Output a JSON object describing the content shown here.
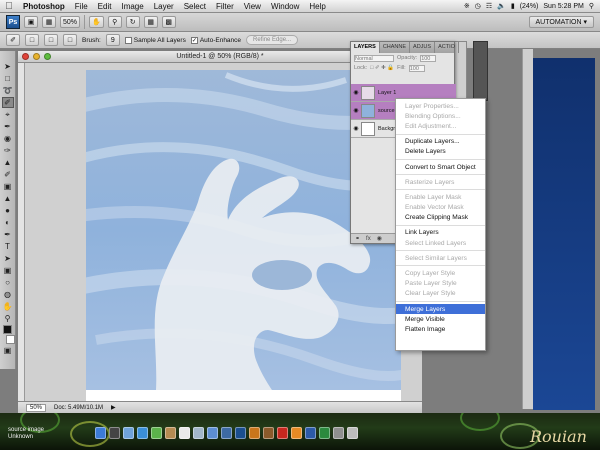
{
  "menubar": {
    "app_name": "Photoshop",
    "items": [
      "File",
      "Edit",
      "Image",
      "Layer",
      "Select",
      "Filter",
      "View",
      "Window",
      "Help"
    ],
    "battery": "(24%)",
    "clock": "Sun 5:28 PM"
  },
  "appbar": {
    "ps_label": "Ps",
    "zoom": "50%",
    "workspace": "AUTOMATION ▾"
  },
  "options": {
    "brush_label": "Brush:",
    "brush_size": "9",
    "sample_all_layers": "Sample All Layers",
    "auto_enhance": "Auto-Enhance",
    "refine_edge": "Refine Edge..."
  },
  "document": {
    "title": "Untitled-1 @ 50% (RGB/8) *",
    "zoom": "50%",
    "doc_size": "Doc: 5.49M/10.1M"
  },
  "layers_panel": {
    "tabs": [
      "LAYERS",
      "CHANNE",
      "ADJUS",
      "ACTIO"
    ],
    "blend_mode": "Normal",
    "opacity_label": "Opacity:",
    "opacity_value": "100",
    "lock_label": "Lock:",
    "fill_label": "Fill:",
    "fill_value": "100",
    "layers": [
      {
        "name": "Layer 1"
      },
      {
        "name": "source"
      },
      {
        "name": "Backgro"
      }
    ],
    "footer": "fx"
  },
  "context_menu": {
    "items": [
      {
        "label": "Layer Properties...",
        "disabled": true
      },
      {
        "label": "Blending Options...",
        "disabled": true
      },
      {
        "label": "Edit Adjustment...",
        "disabled": true
      },
      {
        "label": "Duplicate Layers...",
        "disabled": false
      },
      {
        "label": "Delete Layers",
        "disabled": false
      },
      {
        "label": "Convert to Smart Object",
        "disabled": false
      },
      {
        "label": "Rasterize Layers",
        "disabled": true
      },
      {
        "label": "Enable Layer Mask",
        "disabled": true
      },
      {
        "label": "Enable Vector Mask",
        "disabled": true
      },
      {
        "label": "Create Clipping Mask",
        "disabled": false
      },
      {
        "label": "Link Layers",
        "disabled": false
      },
      {
        "label": "Select Linked Layers",
        "disabled": true
      },
      {
        "label": "Select Similar Layers",
        "disabled": true
      },
      {
        "label": "Copy Layer Style",
        "disabled": true
      },
      {
        "label": "Paste Layer Style",
        "disabled": true
      },
      {
        "label": "Clear Layer Style",
        "disabled": true
      },
      {
        "label": "Merge Layers",
        "disabled": false,
        "highlighted": true
      },
      {
        "label": "Merge Visible",
        "disabled": false
      },
      {
        "label": "Flatten Image",
        "disabled": false
      }
    ]
  },
  "dock": {
    "signature_left": "source image\nUnknown",
    "signature_right": "Rouian",
    "icons": [
      "finder",
      "dashboard",
      "mail",
      "safari",
      "ichat",
      "address-book",
      "ical",
      "preview",
      "itunes",
      "iphoto",
      "photoshop",
      "illustrator",
      "bridge",
      "acrobat",
      "firefox",
      "word",
      "excel",
      "system-prefs",
      "trash"
    ]
  },
  "colors": {
    "menu_highlight": "#3e6fd8",
    "selected_layer": "#b57fc0",
    "sky": "#8fb2dc",
    "desktop_blue": "#1b4795"
  }
}
